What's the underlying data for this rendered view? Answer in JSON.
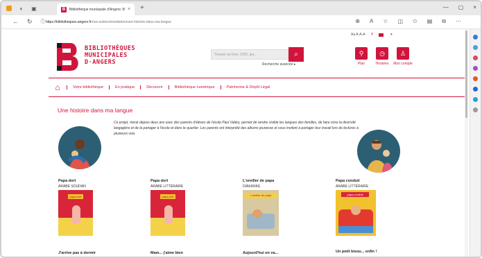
{
  "browser": {
    "tab_title": "Bibliothèque municipale d'Angers: Mu...",
    "tab_close": "×",
    "new_tab": "+",
    "url_host": "https://bibliotheques.angers.fr",
    "url_path": "/nos-actions/mediation/une-histoire-dans-ma-langue",
    "window_controls": [
      "—",
      "▢",
      "×"
    ]
  },
  "header": {
    "logo_lines": [
      "BIBLIOTHÈQUES",
      "MUNICIPALES",
      "D·ANGERS"
    ],
    "social_text": "Aa  A-A-A",
    "search_placeholder": "Trouver un livre, DVD, jeu...",
    "advanced_search": "Recherche avancée ▸",
    "accounts": [
      {
        "label": "Plan",
        "icon": "map-icon"
      },
      {
        "label": "Horaires",
        "icon": "clock-icon"
      },
      {
        "label": "Mon compte",
        "icon": "user-icon"
      }
    ]
  },
  "menu": {
    "items": [
      "Votre bibliothèque",
      "En pratique",
      "Découvrir",
      "Bibliothèque numérique",
      "Patrimoine & Dépôt Légal"
    ]
  },
  "content": {
    "title": "Une histoire dans ma langue",
    "intro": "Ce projet, mené depuis deux ans avec des parents d'élèves de l'école Paul Valéry, permet de rendre visible les langues des familles, de faire vivre la diversité langagière et de la partager à l'école et dans le quartier. Les parents ont interprété des albums jeunesse et vous invitent à partager leur travail lors de lectures à plusieurs voix.",
    "books": [
      {
        "title": "Papa dort",
        "lang": "ARABE SOUDAN",
        "cover": "papa dort"
      },
      {
        "title": "Papa dort",
        "lang": "ARABE LITTÉRAIRE",
        "cover": "papa dort"
      },
      {
        "title": "L'oreiller de papa",
        "lang": "DIAKANKE",
        "cover": "L'oreiller de papa"
      },
      {
        "title": "Papa conduit",
        "lang": "ARABE LITTÉRAIRE",
        "cover": "papa conduit"
      }
    ],
    "next_titles": [
      "J'arrive pas à dormir",
      "Mam... j'aime bien",
      "Aujourd'hui on va...",
      "Un petit bisou... enfin !"
    ]
  },
  "colors": {
    "brand": "#d0153d",
    "circle": "#2d5f74"
  }
}
